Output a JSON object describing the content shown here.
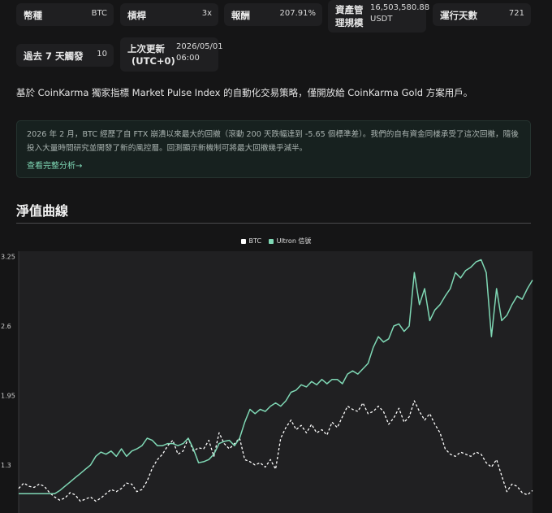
{
  "stats": {
    "coin_label": "幣種",
    "coin_value": "BTC",
    "leverage_label": "槓桿",
    "leverage_value": "3x",
    "return_label": "報酬",
    "return_value": "207.91%",
    "aum_label_1": "資產管",
    "aum_label_2": "理規模",
    "aum_value_1": "16,503,580.88",
    "aum_value_2": "USDT",
    "days_label": "運行天數",
    "days_value": "721",
    "signals_label": "過去 7 天觸發",
    "signals_value": "10",
    "updated_label_1": "上次更新",
    "updated_label_2": "(UTC+0)",
    "updated_value_1": "2026/05/01",
    "updated_value_2": "06:00"
  },
  "description": "基於 CoinKarma 獨家指標 Market Pulse Index 的自動化交易策略，僅開放給 CoinKarma Gold 方案用戶。",
  "notice": {
    "text": "2026 年 2 月，BTC 經歷了自 FTX 崩潰以來最大的回撤（滾動 200 天跌幅達到 -5.65 個標準差）。我們的自有資金同樣承受了這次回撤，隨後投入大量時間研究並開發了新的風控層。回測顯示新機制可將最大回撤幾乎減半。",
    "link": "查看完整分析→"
  },
  "section_title": "淨值曲線",
  "colors": {
    "btc": "#ffffff",
    "ultron": "#7fd8b5",
    "bg": "#151516",
    "plot_bg": "#202022"
  },
  "chart_data": {
    "type": "line",
    "x_points": 101,
    "yticks": [
      "3.25",
      "2.6",
      "1.95",
      "1.3"
    ],
    "ytick_values": [
      3.25,
      2.6,
      1.95,
      1.3
    ],
    "ylim": [
      0.85,
      3.3
    ],
    "legend_position": "top-center",
    "series": [
      {
        "name": "BTC",
        "color": "#ffffff",
        "style": "dashed",
        "values": [
          1.08,
          1.13,
          1.1,
          1.09,
          1.12,
          1.1,
          1.04,
          1.0,
          0.97,
          0.99,
          1.04,
          1.02,
          0.96,
          0.98,
          1.0,
          0.96,
          0.99,
          1.03,
          1.07,
          1.05,
          1.08,
          1.13,
          1.12,
          1.05,
          1.07,
          1.15,
          1.27,
          1.35,
          1.4,
          1.48,
          1.53,
          1.4,
          1.43,
          1.55,
          1.43,
          1.46,
          1.45,
          1.53,
          1.38,
          1.6,
          1.5,
          1.45,
          1.5,
          1.55,
          1.35,
          1.33,
          1.3,
          1.32,
          1.28,
          1.35,
          1.26,
          1.55,
          1.65,
          1.72,
          1.63,
          1.67,
          1.6,
          1.68,
          1.6,
          1.63,
          1.58,
          1.7,
          1.65,
          1.75,
          1.85,
          1.82,
          1.8,
          1.88,
          1.78,
          1.8,
          1.85,
          1.8,
          1.68,
          1.74,
          1.83,
          1.7,
          1.75,
          1.9,
          1.8,
          1.72,
          1.78,
          1.68,
          1.6,
          1.45,
          1.4,
          1.38,
          1.42,
          1.4,
          1.38,
          1.42,
          1.4,
          1.32,
          1.28,
          1.35,
          1.2,
          1.05,
          1.12,
          1.1,
          1.04,
          1.02,
          1.06
        ]
      },
      {
        "name": "Ultron 信號",
        "color": "#7fd8b5",
        "style": "solid",
        "values": [
          1.03,
          1.03,
          1.03,
          1.03,
          1.03,
          1.03,
          1.03,
          1.03,
          1.06,
          1.1,
          1.14,
          1.18,
          1.22,
          1.26,
          1.3,
          1.38,
          1.42,
          1.4,
          1.43,
          1.38,
          1.45,
          1.38,
          1.43,
          1.45,
          1.48,
          1.55,
          1.53,
          1.48,
          1.48,
          1.5,
          1.5,
          1.48,
          1.5,
          1.55,
          1.45,
          1.32,
          1.33,
          1.35,
          1.4,
          1.5,
          1.52,
          1.53,
          1.48,
          1.55,
          1.7,
          1.82,
          1.78,
          1.82,
          1.8,
          1.85,
          1.88,
          1.85,
          1.9,
          1.98,
          2.0,
          2.05,
          2.03,
          2.08,
          2.05,
          2.1,
          2.06,
          2.1,
          2.1,
          2.06,
          2.15,
          2.18,
          2.15,
          2.2,
          2.25,
          2.4,
          2.5,
          2.45,
          2.48,
          2.6,
          2.62,
          2.55,
          2.6,
          3.1,
          2.8,
          2.95,
          2.65,
          2.75,
          2.8,
          2.88,
          2.95,
          3.1,
          3.05,
          3.12,
          3.15,
          3.2,
          3.22,
          3.1,
          2.5,
          2.95,
          2.65,
          2.7,
          2.8,
          2.88,
          2.85,
          2.95,
          3.03
        ]
      }
    ]
  }
}
